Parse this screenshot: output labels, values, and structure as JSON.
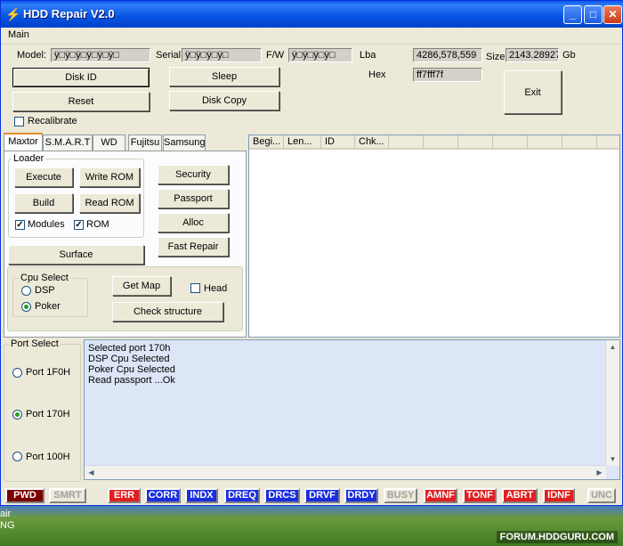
{
  "window": {
    "title": "HDD Repair V2.0",
    "minimize": "_",
    "maximize": "□",
    "close": "✕"
  },
  "menu": {
    "main": "Main"
  },
  "info": {
    "model_label": "Model:",
    "model_value": "ÿ□ÿ□ÿ□ÿ□ÿ□ÿ□",
    "serial_label": "Serial",
    "serial_value": "ÿ□ÿ□ÿ□ÿ□",
    "fw_label": "F/W",
    "fw_value": "ÿ□ÿ□ÿ□ÿ□",
    "lba_label": "Lba",
    "lba_value": "4286,578,559",
    "size_label": "Size",
    "size_value": "2143.28927",
    "size_unit": "Gb",
    "hex_label": "Hex",
    "hex_value": "ff7fff7f"
  },
  "buttons": {
    "disk_id": "Disk ID",
    "sleep": "Sleep",
    "reset": "Reset",
    "disk_copy": "Disk Copy",
    "exit": "Exit",
    "recalibrate": "Recalibrate"
  },
  "tabs": [
    "Maxtor",
    "S.M.A.R.T",
    "WD",
    "Fujitsu",
    "Samsung"
  ],
  "maxtor": {
    "loader_title": "Loader",
    "execute": "Execute",
    "write_rom": "Write ROM",
    "build": "Build",
    "read_rom": "Read ROM",
    "modules": "Modules",
    "rom": "ROM",
    "surface": "Surface",
    "security": "Security",
    "passport": "Passport",
    "alloc": "Alloc",
    "fast_repair": "Fast Repair",
    "cpu_title": "Cpu Select",
    "dsp": "DSP",
    "poker": "Poker",
    "get_map": "Get Map",
    "head": "Head",
    "check_structure": "Check structure",
    "check_mark": "✓"
  },
  "list_columns": [
    "Begi...",
    "Len...",
    "ID",
    "Chk..."
  ],
  "ports": {
    "title": "Port Select",
    "items": [
      "Port 1F0H",
      "Port 170H",
      "Port 100H"
    ]
  },
  "log": {
    "lines": [
      "Selected port 170h",
      "DSP Cpu Selected",
      "Poker Cpu Selected",
      "Read passport ...Ok"
    ]
  },
  "status": {
    "leds": [
      {
        "label": "PWD",
        "bg": "#7a0000",
        "fg": "#ffffff"
      },
      {
        "label": "SMRT",
        "bg": "#ece9d8",
        "fg": "#a0a0a0"
      },
      {
        "label": "ERR",
        "bg": "#e02020",
        "fg": "#ffffff"
      },
      {
        "label": "CORR",
        "bg": "#1a2ee0",
        "fg": "#ffffff"
      },
      {
        "label": "INDX",
        "bg": "#1a2ee0",
        "fg": "#ffffff"
      },
      {
        "label": "DREQ",
        "bg": "#1a2ee0",
        "fg": "#ffffff"
      },
      {
        "label": "DRCS",
        "bg": "#1a2ee0",
        "fg": "#ffffff"
      },
      {
        "label": "DRVF",
        "bg": "#1a2ee0",
        "fg": "#ffffff"
      },
      {
        "label": "DRDY",
        "bg": "#1a2ee0",
        "fg": "#ffffff"
      },
      {
        "label": "BUSY",
        "bg": "#ece9d8",
        "fg": "#a0a0a0"
      },
      {
        "label": "AMNF",
        "bg": "#e02020",
        "fg": "#ffffff"
      },
      {
        "label": "TONF",
        "bg": "#e02020",
        "fg": "#ffffff"
      },
      {
        "label": "ABRT",
        "bg": "#e02020",
        "fg": "#ffffff"
      },
      {
        "label": "IDNF",
        "bg": "#e02020",
        "fg": "#ffffff"
      },
      {
        "label": "UNC",
        "bg": "#ece9d8",
        "fg": "#a0a0a0"
      }
    ]
  },
  "desktop": {
    "text_1": "air",
    "text_2": "NG",
    "watermark": "FORUM.HDDGURU.COM"
  }
}
